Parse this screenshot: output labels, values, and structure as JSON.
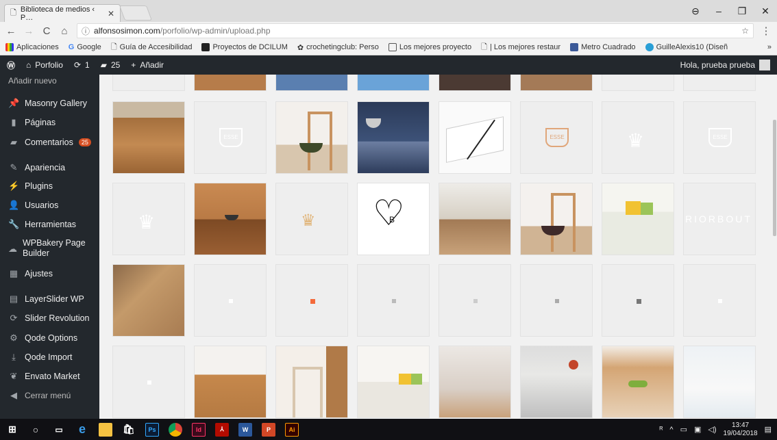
{
  "browser": {
    "tab_title": "Biblioteca de medios ‹ P…",
    "url_host": "alfonsosimon.com",
    "url_path": "/porfolio/wp-admin/upload.php",
    "bookmarks": [
      {
        "label": "Aplicaciones",
        "color": "#e33"
      },
      {
        "label": "Google",
        "color": "#4285f4"
      },
      {
        "label": "Guía de Accesibilidad",
        "color": "#999"
      },
      {
        "label": "Proyectos de DCILUM",
        "color": "#222"
      },
      {
        "label": "crochetingclub: Perso",
        "color": "#333"
      },
      {
        "label": "Los mejores proyecto",
        "color": "#555"
      },
      {
        "label": "| Los mejores restaur",
        "color": "#999"
      },
      {
        "label": "Metro Cuadrado",
        "color": "#3b5998"
      },
      {
        "label": "GuilleAlexis10 (Diseñ",
        "color": "#2a9fd6"
      }
    ],
    "more_bookmarks": "»"
  },
  "adminbar": {
    "site_name": "Porfolio",
    "updates": "1",
    "comments": "25",
    "add_new": "Añadir",
    "greeting": "Hola, prueba prueba"
  },
  "sidebar": {
    "submenu_add_new": "Añadir nuevo",
    "items": [
      {
        "label": "Masonry Gallery",
        "icon": "pin-icon"
      },
      {
        "label": "Páginas",
        "icon": "page-icon"
      },
      {
        "label": "Comentarios",
        "icon": "comment-icon",
        "badge": "25"
      },
      {
        "label": "Apariencia",
        "icon": "brush-icon"
      },
      {
        "label": "Plugins",
        "icon": "plug-icon"
      },
      {
        "label": "Usuarios",
        "icon": "user-icon"
      },
      {
        "label": "Herramientas",
        "icon": "wrench-icon"
      },
      {
        "label": "WPBakery Page Builder",
        "icon": "wpbakery-icon"
      },
      {
        "label": "Ajustes",
        "icon": "settings-icon"
      },
      {
        "label": "LayerSlider WP",
        "icon": "layers-icon"
      },
      {
        "label": "Slider Revolution",
        "icon": "refresh-icon"
      },
      {
        "label": "Qode Options",
        "icon": "gear-icon"
      },
      {
        "label": "Qode Import",
        "icon": "import-icon"
      },
      {
        "label": "Envato Market",
        "icon": "leaf-icon"
      },
      {
        "label": "Cerrar menú",
        "icon": "collapse-icon"
      }
    ]
  },
  "media": {
    "watermark_text": "RIORBOUT",
    "esse_text": "ESSE",
    "b_text": "B"
  },
  "taskbar": {
    "time": "13:47",
    "date": "19/04/2018",
    "apps": [
      "Ps",
      "Id",
      "W",
      "P",
      "Ai"
    ]
  }
}
